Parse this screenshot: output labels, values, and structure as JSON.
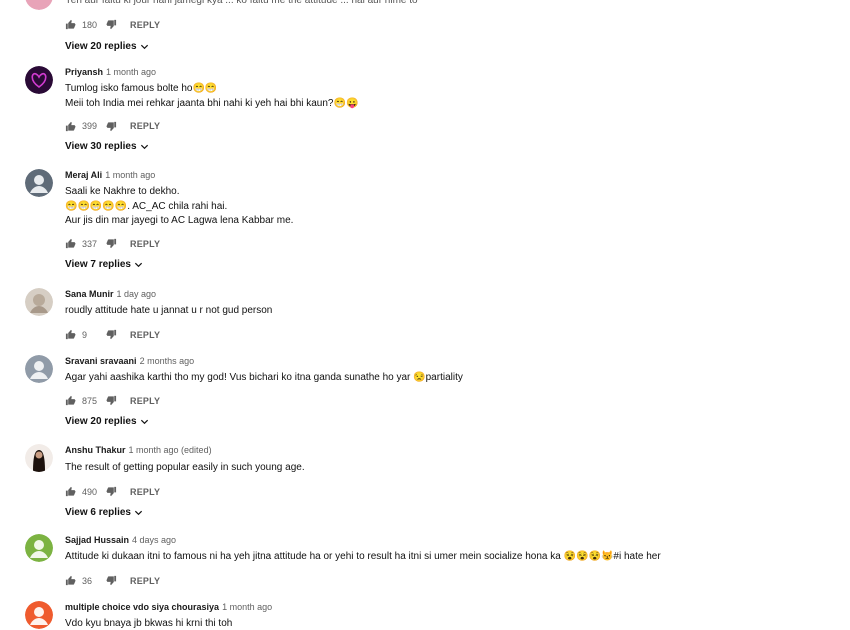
{
  "top_partial": {
    "text": "Yeh aur faltu ki jour nahi jamegi kya ... ko faltu me the attitude ... hai aur hime to",
    "likes": "180",
    "reply_label": "REPLY",
    "view_replies": "View 20 replies"
  },
  "comments": [
    {
      "author": "Priyansh",
      "time": "1 month ago",
      "lines": [
        "Tumlog isko famous bolte ho😁😁",
        "Meii toh India mei rehkar jaanta bhi nahi ki yeh hai bhi kaun?😁😛"
      ],
      "likes": "399",
      "reply_label": "REPLY",
      "view_replies": "View 30 replies",
      "avatar_color": "#3b0d4a"
    },
    {
      "author": "Meraj Ali",
      "time": "1 month ago",
      "lines": [
        "Saali ke Nakhre to dekho.",
        "😁😁😁😁😁. AC_AC chila rahi hai.",
        "Aur jis din mar jayegi to AC Lagwa lena Kabbar me."
      ],
      "likes": "337",
      "reply_label": "REPLY",
      "view_replies": "View 7 replies",
      "avatar_color": "#5a6572"
    },
    {
      "author": "Sana Munir",
      "time": "1 day ago",
      "lines": [
        "roudly attitude hate u jannat u r not gud person"
      ],
      "likes": "9",
      "reply_label": "REPLY",
      "view_replies": "",
      "avatar_color": "#c9bfb4"
    },
    {
      "author": "Sravani sravaani",
      "time": "2 months ago",
      "lines": [
        "Agar yahi aashika karthi tho my god! Vus bichari ko itna ganda sunathe ho yar 😒partiality"
      ],
      "likes": "875",
      "reply_label": "REPLY",
      "view_replies": "View 20 replies",
      "avatar_color": "#8d99a6"
    },
    {
      "author": "Anshu Thakur",
      "time": "1 month ago (edited)",
      "lines": [
        "The result of getting popular easily in such young age."
      ],
      "likes": "490",
      "reply_label": "REPLY",
      "view_replies": "View 6 replies",
      "avatar_color": "#2a1a14"
    },
    {
      "author": "Sajjad Hussain",
      "time": "4 days ago",
      "lines": [
        "Attitude ki dukaan itni to famous ni ha yeh jitna attitude ha or yehi to result ha itni si umer mein socialize hona ka 😵😵😵😾#i hate her"
      ],
      "likes": "36",
      "reply_label": "REPLY",
      "view_replies": "",
      "avatar_color": "#7cb342"
    },
    {
      "author": "multiple choice vdo siya chourasiya",
      "time": "1 month ago",
      "lines": [
        "Vdo kyu bnaya jb bkwas hi krni thi toh"
      ],
      "likes": "",
      "reply_label": "",
      "view_replies": "",
      "avatar_color": "#ef5b2e"
    }
  ],
  "icons": {
    "like": "thumbs-up-icon",
    "dislike": "thumbs-down-icon",
    "chevron": "chevron-down-icon",
    "avatar_default": "user-silhouette-icon"
  }
}
